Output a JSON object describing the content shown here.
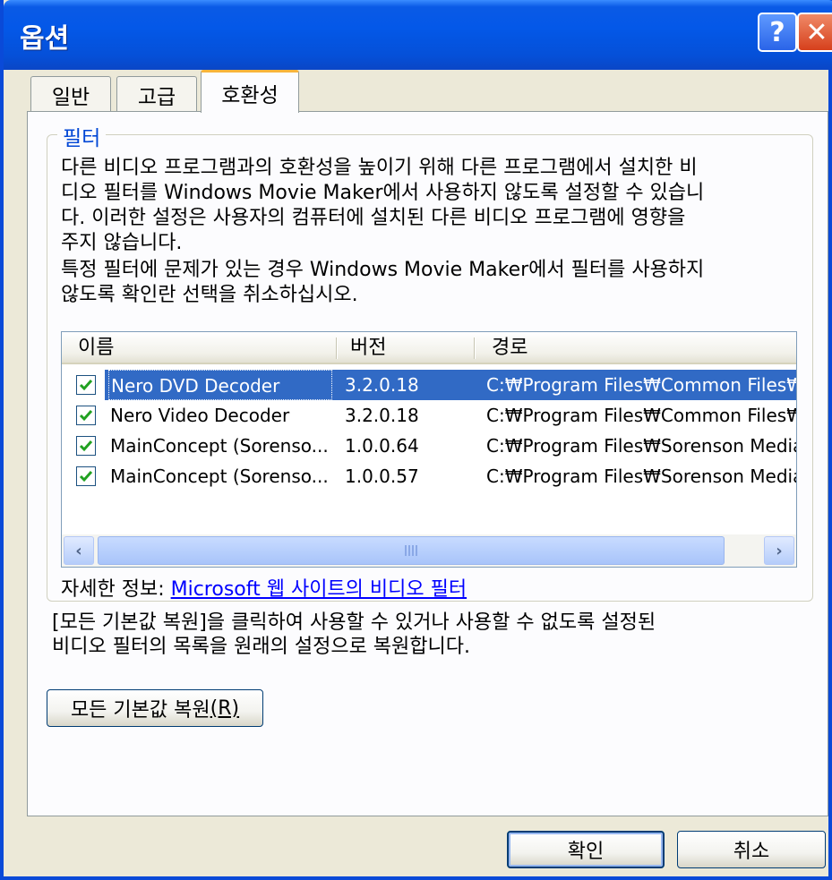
{
  "window": {
    "title": "옵션",
    "help_label": "?",
    "close_label": "✕"
  },
  "tabs": [
    {
      "label": "일반"
    },
    {
      "label": "고급"
    },
    {
      "label": "호환성"
    }
  ],
  "filter_group": {
    "title": "필터",
    "description_1": "다른 비디오 프로그램과의 호환성을 높이기 위해 다른 프로그램에서 설치한 비디오 필터를 Windows Movie Maker에서 사용하지 않도록 설정할 수 있습니다. 이러한 설정은 사용자의 컴퓨터에 설치된 다른 비디오 프로그램에 영향을 주지 않습니다.",
    "description_2": "특정 필터에 문제가 있는 경우 Windows Movie Maker에서 필터를 사용하지 않도록 확인란 선택을 취소하십시오.",
    "columns": [
      "이름",
      "버전",
      "경로"
    ],
    "rows": [
      {
        "name": "Nero DVD Decoder",
        "version": "3.2.0.18",
        "path": "C:₩Program Files₩Common Files₩",
        "checked": true,
        "selected": true
      },
      {
        "name": "Nero Video Decoder",
        "version": "3.2.0.18",
        "path": "C:₩Program Files₩Common Files₩",
        "checked": true,
        "selected": false
      },
      {
        "name": "MainConcept (Sorenso...",
        "version": "1.0.0.64",
        "path": "C:₩Program Files₩Sorenson Media",
        "checked": true,
        "selected": false
      },
      {
        "name": "MainConcept (Sorenso...",
        "version": "1.0.0.57",
        "path": "C:₩Program Files₩Sorenson Media",
        "checked": true,
        "selected": false
      }
    ],
    "more_info_label": "자세한 정보:",
    "more_info_link": "Microsoft 웹 사이트의 비디오 필터"
  },
  "restore": {
    "description": "[모든 기본값 복원]을 클릭하여 사용할 수 있거나 사용할 수 없도록 설정된 비디오 필터의 목록을 원래의 설정으로 복원합니다.",
    "button_label": "모든 기본값 복원",
    "button_accel": "(R)"
  },
  "footer": {
    "ok_label": "확인",
    "cancel_label": "취소"
  },
  "colors": {
    "titlebar": "#0458e8",
    "selection": "#316ac5",
    "group_title": "#0046d5",
    "link": "#0000ff"
  }
}
